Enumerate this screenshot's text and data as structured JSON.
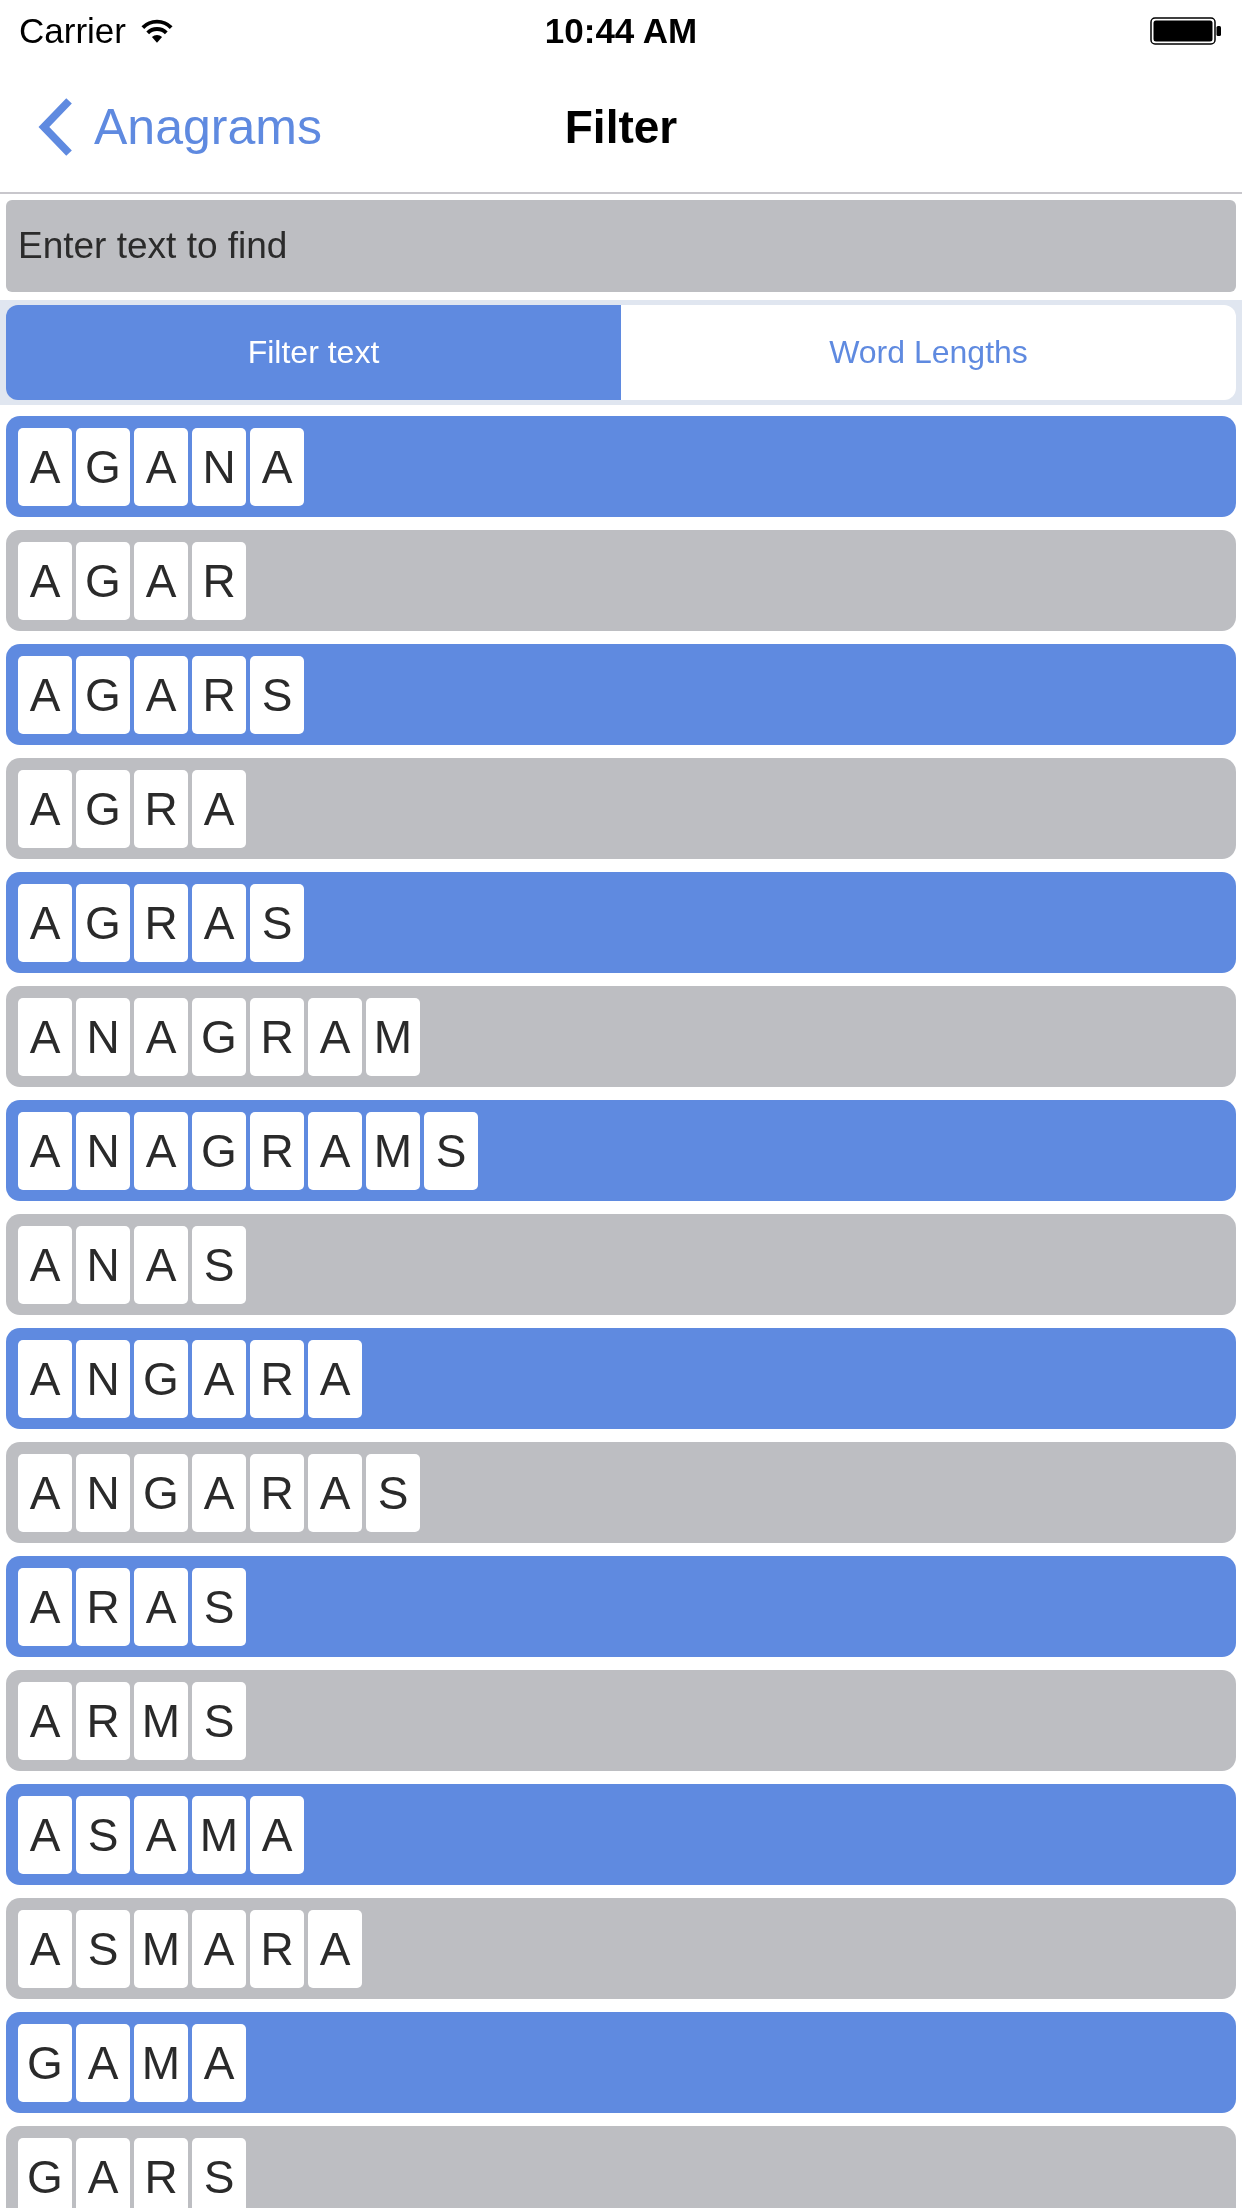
{
  "status_bar": {
    "carrier": "Carrier",
    "time": "10:44 AM"
  },
  "nav_bar": {
    "back_label": "Anagrams",
    "title": "Filter"
  },
  "search": {
    "placeholder": "Enter text to find"
  },
  "segments": [
    {
      "label": "Filter text",
      "selected": true
    },
    {
      "label": "Word Lengths",
      "selected": false
    }
  ],
  "words": [
    {
      "letters": [
        "A",
        "G",
        "A",
        "N",
        "A"
      ]
    },
    {
      "letters": [
        "A",
        "G",
        "A",
        "R"
      ]
    },
    {
      "letters": [
        "A",
        "G",
        "A",
        "R",
        "S"
      ]
    },
    {
      "letters": [
        "A",
        "G",
        "R",
        "A"
      ]
    },
    {
      "letters": [
        "A",
        "G",
        "R",
        "A",
        "S"
      ]
    },
    {
      "letters": [
        "A",
        "N",
        "A",
        "G",
        "R",
        "A",
        "M"
      ]
    },
    {
      "letters": [
        "A",
        "N",
        "A",
        "G",
        "R",
        "A",
        "M",
        "S"
      ]
    },
    {
      "letters": [
        "A",
        "N",
        "A",
        "S"
      ]
    },
    {
      "letters": [
        "A",
        "N",
        "G",
        "A",
        "R",
        "A"
      ]
    },
    {
      "letters": [
        "A",
        "N",
        "G",
        "A",
        "R",
        "A",
        "S"
      ]
    },
    {
      "letters": [
        "A",
        "R",
        "A",
        "S"
      ]
    },
    {
      "letters": [
        "A",
        "R",
        "M",
        "S"
      ]
    },
    {
      "letters": [
        "A",
        "S",
        "A",
        "M",
        "A"
      ]
    },
    {
      "letters": [
        "A",
        "S",
        "M",
        "A",
        "R",
        "A"
      ]
    },
    {
      "letters": [
        "G",
        "A",
        "M",
        "A"
      ]
    },
    {
      "letters": [
        "G",
        "A",
        "R",
        "S"
      ]
    }
  ]
}
